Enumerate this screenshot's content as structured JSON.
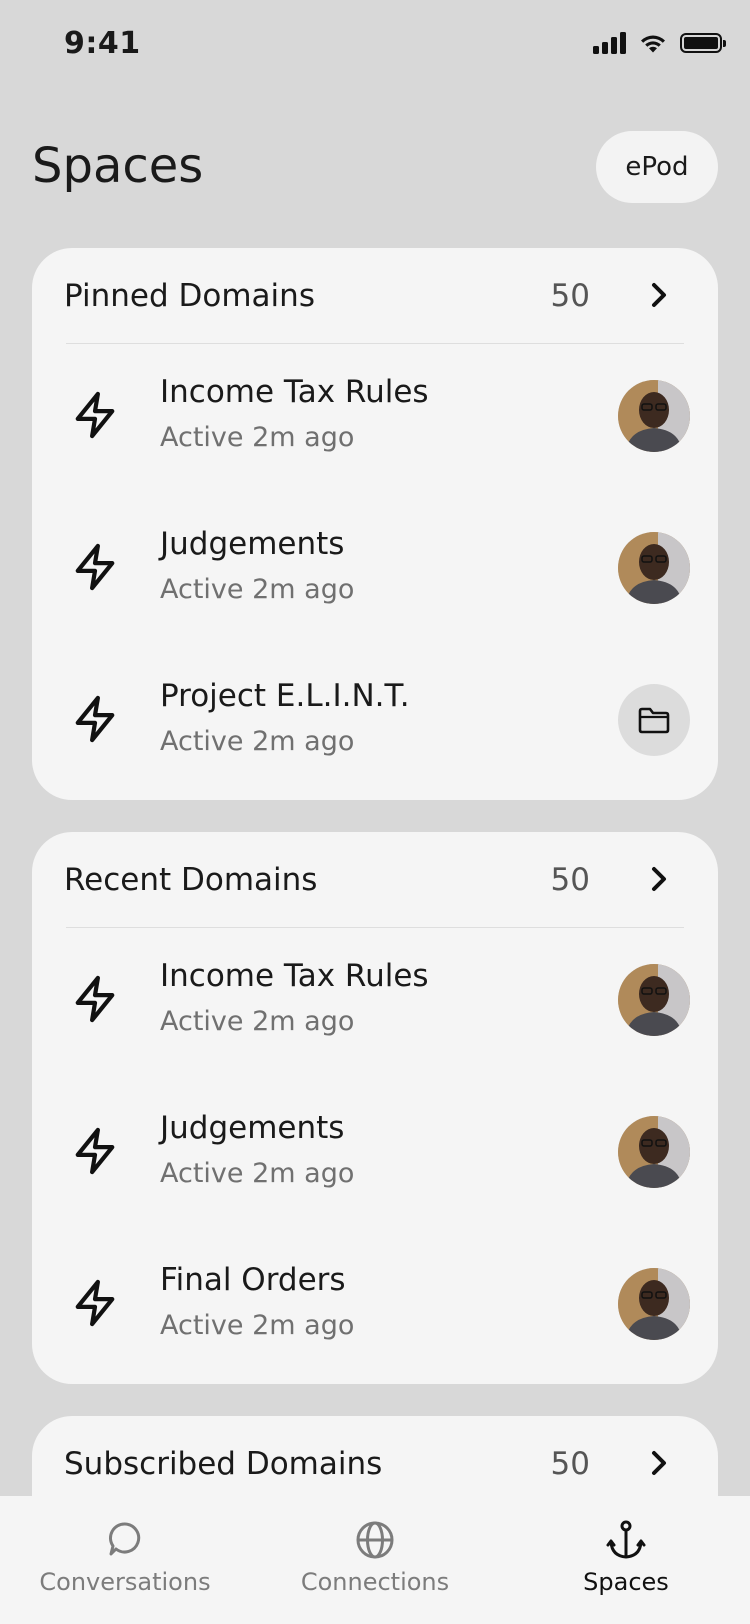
{
  "status_bar": {
    "time": "9:41"
  },
  "header": {
    "title": "Spaces",
    "action_label": "ePod"
  },
  "sections": [
    {
      "title": "Pinned Domains",
      "count": "50",
      "items": [
        {
          "title": "Income Tax Rules",
          "subtitle": "Active 2m ago",
          "badge": "avatar"
        },
        {
          "title": "Judgements",
          "subtitle": "Active 2m ago",
          "badge": "avatar"
        },
        {
          "title": "Project E.L.I.N.T.",
          "subtitle": "Active 2m ago",
          "badge": "folder-icon"
        }
      ]
    },
    {
      "title": "Recent Domains",
      "count": "50",
      "items": [
        {
          "title": "Income Tax Rules",
          "subtitle": "Active 2m ago",
          "badge": "avatar"
        },
        {
          "title": "Judgements",
          "subtitle": "Active 2m ago",
          "badge": "avatar"
        },
        {
          "title": "Final Orders",
          "subtitle": "Active 2m ago",
          "badge": "avatar"
        }
      ]
    },
    {
      "title": "Subscribed Domains",
      "count": "50",
      "items": []
    }
  ],
  "tab_bar": {
    "tabs": [
      {
        "label": "Conversations",
        "icon": "chat-bubble-icon",
        "active": false
      },
      {
        "label": "Connections",
        "icon": "globe-icon",
        "active": false
      },
      {
        "label": "Spaces",
        "icon": "anchor-icon",
        "active": true
      }
    ]
  }
}
